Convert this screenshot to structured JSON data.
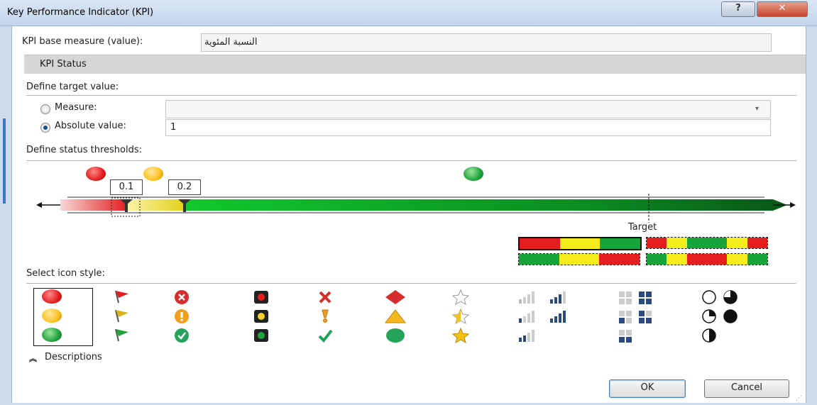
{
  "window": {
    "title": "Key Performance Indicator (KPI)",
    "help_label": "?",
    "close_label": "✕"
  },
  "base_measure": {
    "label": "KPI base measure (value):",
    "value": "النسبة المئوية"
  },
  "status_section": {
    "label": "KPI Status"
  },
  "target": {
    "heading": "Define target value:",
    "measure_label": "Measure:",
    "measure_value": "",
    "absolute_label": "Absolute value:",
    "absolute_value": "1",
    "selected": "absolute"
  },
  "thresholds": {
    "heading": "Define status thresholds:",
    "threshold_1": "0.1",
    "threshold_2": "0.2",
    "target_label": "Target",
    "colors": {
      "red": "#e41e1e",
      "yellow": "#f2e82a",
      "green": "#17a43a",
      "dark_green": "#0b6b1c"
    }
  },
  "icon_style": {
    "heading": "Select icon style:",
    "selected_column": 0
  },
  "descriptions": {
    "label": "Descriptions",
    "icon": "double-chevron-up-icon"
  },
  "buttons": {
    "ok": "OK",
    "cancel": "Cancel"
  }
}
